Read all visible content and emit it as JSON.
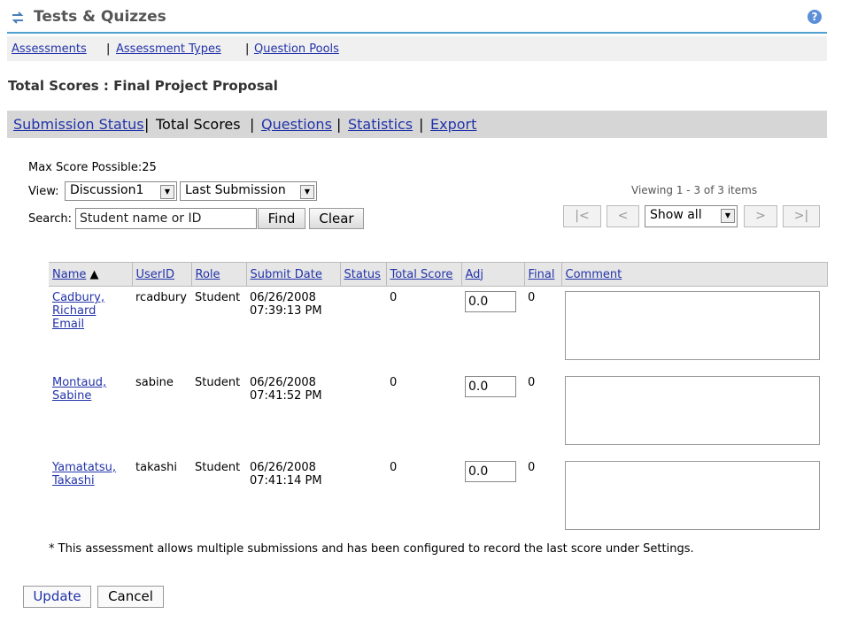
{
  "app": {
    "title": "Tests & Quizzes",
    "help_glyph": "?"
  },
  "topnav": {
    "assessments": "Assessments",
    "sep": "|",
    "types": "Assessment Types",
    "pools": "Question Pools"
  },
  "page": {
    "title": "Total Scores : Final Project Proposal"
  },
  "subnav": {
    "submission_status": "Submission Status",
    "sep": "|",
    "total_scores": "Total Scores",
    "questions": "Questions",
    "statistics": "Statistics",
    "export": "Export"
  },
  "filters": {
    "max_score": "Max Score Possible:25",
    "view_label": "View:",
    "view_value": "Discussion1",
    "submission_value": "Last Submission",
    "search_label": "Search:",
    "search_value": "Student name or ID",
    "find_label": "Find",
    "clear_label": "Clear"
  },
  "pager": {
    "viewing": "Viewing 1 - 3 of 3 items",
    "first": "|<",
    "prev": "<",
    "show": "Show all",
    "next": ">",
    "last": ">|"
  },
  "table": {
    "headers": {
      "name": "Name",
      "userid": "UserID",
      "role": "Role",
      "submit": "Submit Date",
      "status": "Status",
      "total": "Total Score",
      "adj": "Adj",
      "final": "Final",
      "comment": "Comment"
    },
    "rows": [
      {
        "name1": "Cadbury,",
        "name2": "Richard",
        "email": "Email",
        "userid": "rcadbury",
        "role": "Student",
        "date": "06/26/2008",
        "time": "07:39:13 PM",
        "total": "0",
        "adj": "0.0",
        "final": "0"
      },
      {
        "name1": "Montaud,",
        "name2": "Sabine",
        "email": "",
        "userid": "sabine",
        "role": "Student",
        "date": "06/26/2008",
        "time": "07:41:52 PM",
        "total": "0",
        "adj": "0.0",
        "final": "0"
      },
      {
        "name1": "Yamatatsu,",
        "name2": "Takashi",
        "email": "",
        "userid": "takashi",
        "role": "Student",
        "date": "06/26/2008",
        "time": "07:41:14 PM",
        "total": "0",
        "adj": "0.0",
        "final": "0"
      }
    ]
  },
  "note": "* This assessment allows multiple submissions and has been configured to record the last score under Settings.",
  "footer": {
    "update": "Update",
    "cancel": "Cancel"
  },
  "colors": {
    "accent": "#4fa0d0",
    "link": "#2233aa",
    "header_bg": "#e6e6e6"
  }
}
